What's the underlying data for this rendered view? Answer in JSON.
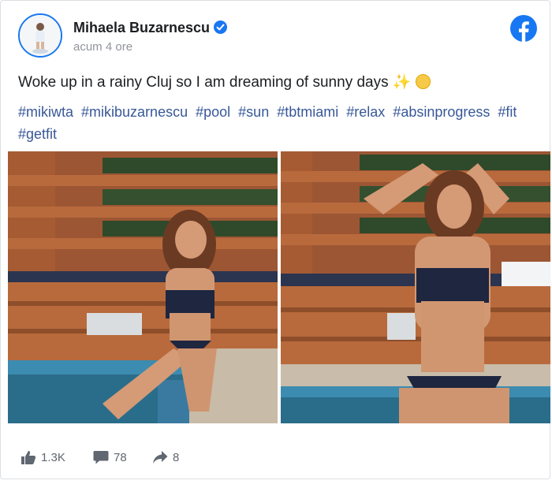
{
  "post": {
    "author": "Mihaela Buzarnescu",
    "timestamp": "acum 4 ore",
    "text": "Woke up in a rainy Cluj so I am dreaming of sunny days",
    "text_emojis": "✨",
    "hashtags": [
      "#mikiwta",
      "#mikibuzarnescu",
      "#pool",
      "#sun",
      "#tbtmiami",
      "#relax",
      "#absinprogress",
      "#fit",
      "#getfit"
    ]
  },
  "stats": {
    "likes": "1.3K",
    "comments": "78",
    "shares": "8"
  },
  "colors": {
    "brand": "#1877f2",
    "hashtag": "#385898",
    "muted": "#606770"
  },
  "icons": [
    "verified-badge-icon",
    "facebook-logo-icon",
    "like-icon",
    "comment-icon",
    "share-icon"
  ]
}
